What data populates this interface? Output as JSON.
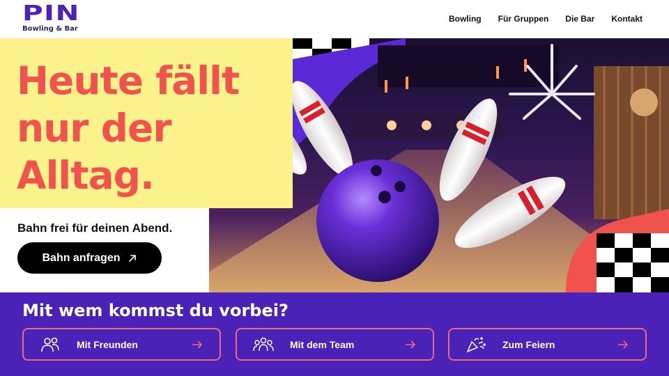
{
  "brand": {
    "name": "PIN",
    "subtitle": "Bowling & Bar",
    "color": "#4a22b8"
  },
  "nav": {
    "items": [
      {
        "label": "Bowling"
      },
      {
        "label": "Für Gruppen"
      },
      {
        "label": "Die Bar"
      },
      {
        "label": "Kontakt"
      }
    ]
  },
  "hero": {
    "headline_lines": [
      "Heute fällt",
      "nur der",
      "Alltag."
    ],
    "tagline": "Bahn frei für deinen Abend.",
    "cta_label": "Bahn anfragen",
    "cta_icon": "arrow-up-right-icon",
    "image": "bowling-ball-hitting-pins-photo"
  },
  "groups": {
    "title": "Mit wem kommst du vorbei?",
    "cards": [
      {
        "label": "Mit Freunden",
        "icon": "friends-icon"
      },
      {
        "label": "Mit dem Team",
        "icon": "team-icon"
      },
      {
        "label": "Zum Feiern",
        "icon": "party-popper-icon"
      }
    ]
  },
  "colors": {
    "accent": "#f0534e",
    "yellow": "#fbf28b",
    "purple": "#4a22b8",
    "card_border": "#f06a7a"
  }
}
